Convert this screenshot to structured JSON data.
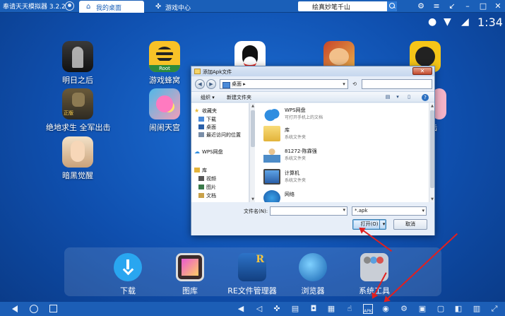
{
  "titlebar": {
    "app_name": "奉请天天模拟器 3.2.2",
    "tabs": [
      {
        "label": "我的桌面",
        "active": true
      },
      {
        "label": "游戏中心",
        "active": false
      }
    ],
    "search_value": "绘真妙笔千山"
  },
  "statusbar": {
    "time": "1:34"
  },
  "desktop_apps": [
    {
      "label": "明日之后"
    },
    {
      "label": "游戏蜂窝"
    },
    {
      "label": "QQ"
    },
    {
      "label": ""
    },
    {
      "label": ""
    },
    {
      "label": "绝地求生 全军出击"
    },
    {
      "label": "闹闹天宫"
    },
    {
      "label": "暗黑觉醒"
    },
    {
      "label": "陆"
    }
  ],
  "dock": [
    {
      "label": "下载"
    },
    {
      "label": "图库"
    },
    {
      "label": "RE文件管理器"
    },
    {
      "label": "浏览器"
    },
    {
      "label": "系统工具"
    }
  ],
  "dialog": {
    "title": "添加Apk文件",
    "address": "桌面",
    "address_sep": "▸",
    "toolbar": {
      "organize": "组织 ▾",
      "new_folder": "新建文件夹"
    },
    "tree": [
      {
        "label": "收藏夹"
      },
      {
        "label": "下载"
      },
      {
        "label": "桌面"
      },
      {
        "label": "最近访问的位置"
      },
      {
        "label": "WPS网盘"
      },
      {
        "label": "库"
      },
      {
        "label": "视频"
      },
      {
        "label": "图片"
      },
      {
        "label": "文档"
      }
    ],
    "files": [
      {
        "name": "WPS网盘",
        "sub": "可打开手机上的文档"
      },
      {
        "name": "库",
        "sub": "系统文件夹"
      },
      {
        "name": "81272-陈霖强",
        "sub": "系统文件夹"
      },
      {
        "name": "计算机",
        "sub": "系统文件夹"
      },
      {
        "name": "网络",
        "sub": ""
      }
    ],
    "filename_label": "文件名(N):",
    "filename_value": "",
    "filter": "*.apk",
    "open_label": "打开(O)",
    "cancel_label": "取消"
  },
  "colors": {
    "accent": "#1a5fb8",
    "annotation": "#e21f1f"
  }
}
